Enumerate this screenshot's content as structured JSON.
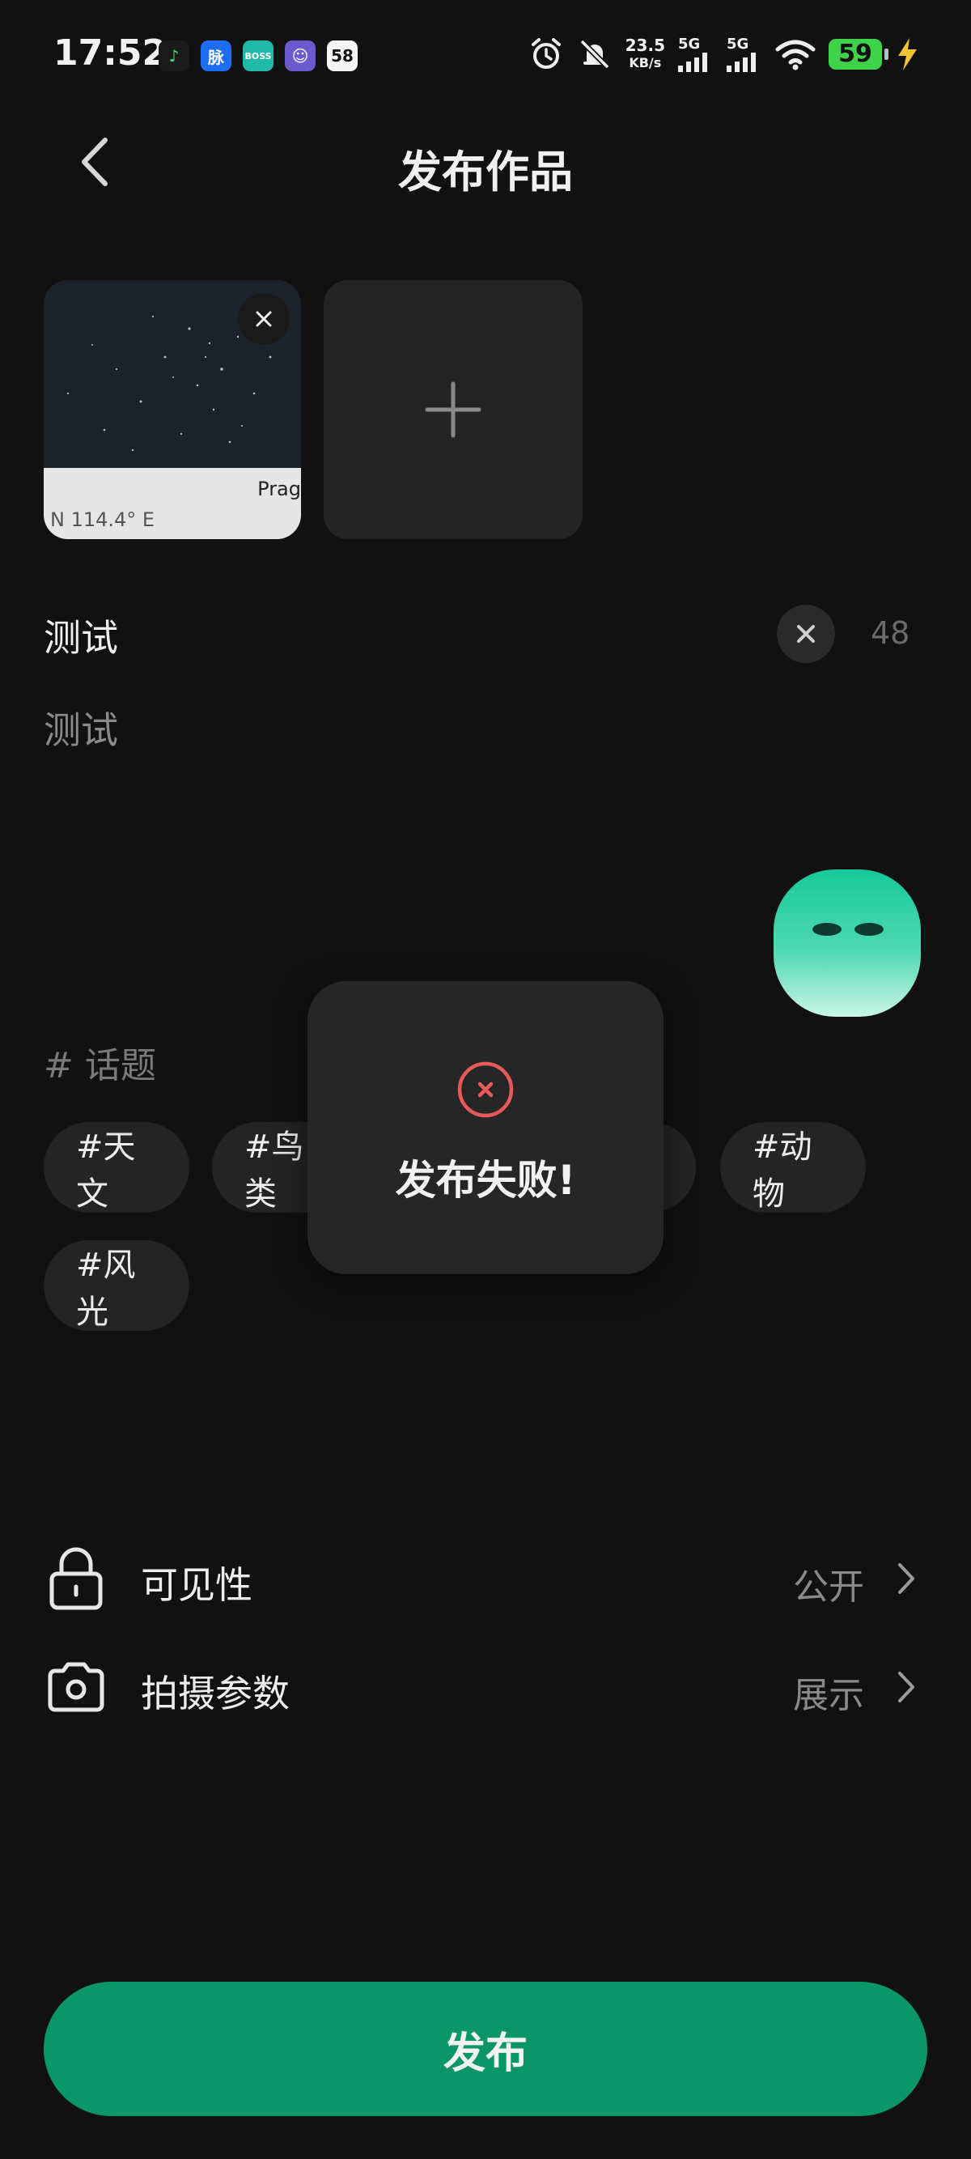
{
  "status_bar": {
    "time": "17:52",
    "app_icons": [
      {
        "name": "music-app-icon",
        "label": "♪",
        "color": "#1a1a1a"
      },
      {
        "name": "maimai-app-icon",
        "label": "脉",
        "color": "#1e6cf0"
      },
      {
        "name": "boss-app-icon",
        "label": "BOSS",
        "color": "#1fb8a9"
      },
      {
        "name": "game-app-icon",
        "label": "☺",
        "color": "#6a5acd"
      },
      {
        "name": "58-app-icon",
        "label": "58",
        "color": "#f5f5f5"
      }
    ],
    "net_speed_value": "23.5",
    "net_speed_unit": "KB/s",
    "signal_1": "5G",
    "signal_2": "5G",
    "battery": "59"
  },
  "header": {
    "title": "发布作品"
  },
  "media": {
    "thumb_location": "Prag",
    "thumb_coords": "N 114.4° E"
  },
  "editor": {
    "title_value": "测试",
    "char_count": "48",
    "body_value": "测试"
  },
  "topics": {
    "label": "# 话题",
    "chips": [
      "#天文",
      "#鸟类",
      "#动物",
      "#风光"
    ]
  },
  "toast": {
    "message": "发布失败!"
  },
  "settings": {
    "visibility_label": "可见性",
    "visibility_value": "公开",
    "camera_label": "拍摄参数",
    "camera_value": "展示"
  },
  "publish": {
    "label": "发布"
  },
  "colors": {
    "background": "#111111",
    "accent": "#0a9669",
    "error": "#e85a5a"
  }
}
